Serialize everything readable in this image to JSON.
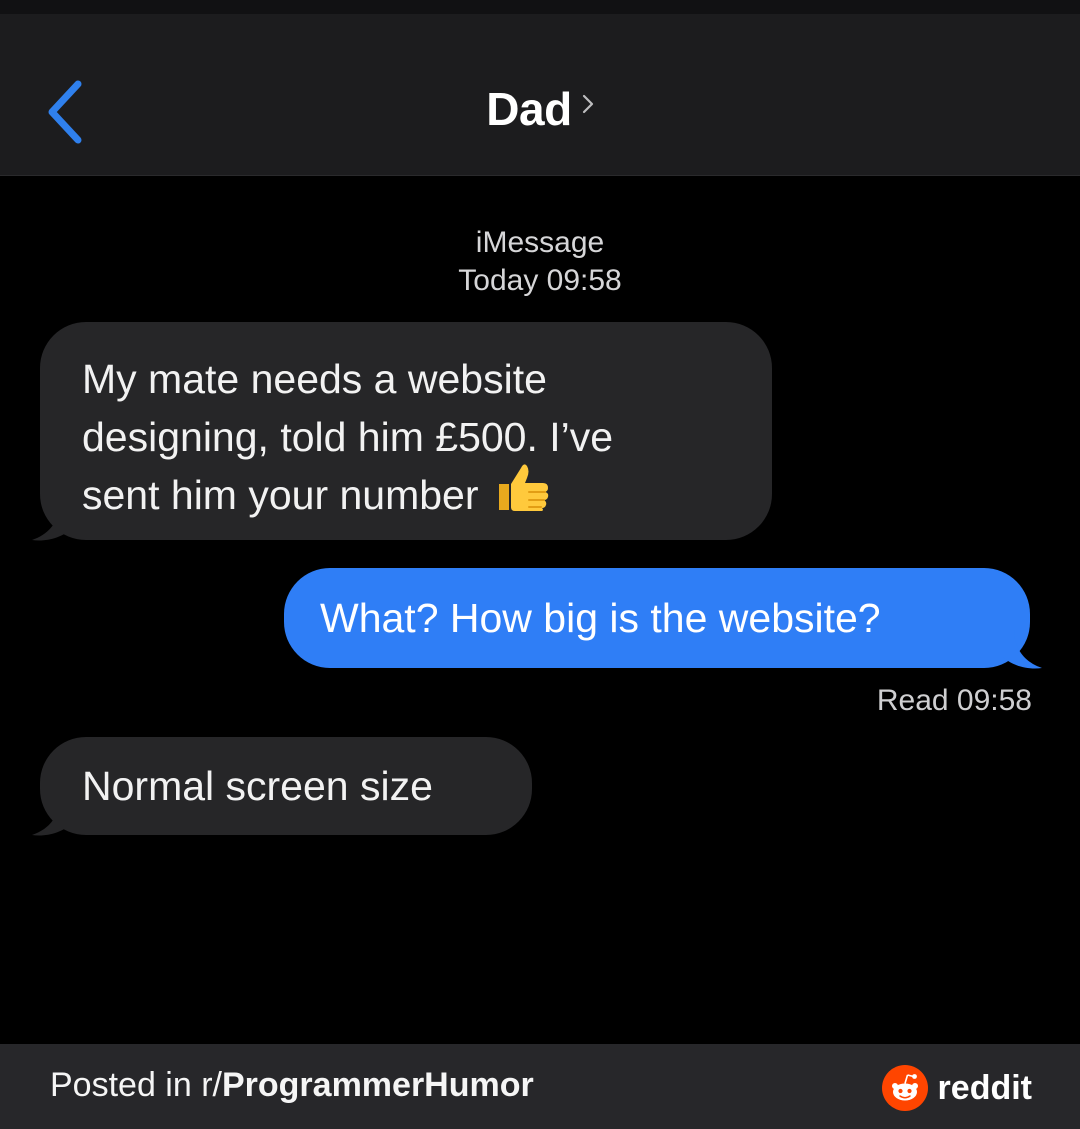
{
  "header": {
    "back_icon": "chevron-left-icon",
    "contact_name": "Dad",
    "details_icon": "chevron-right-icon"
  },
  "conversation": {
    "service": "iMessage",
    "timestamp": "Today 09:58",
    "messages": [
      {
        "direction": "incoming",
        "lines": [
          "My mate needs a website",
          "designing, told him £500. I’ve",
          "sent him your number"
        ],
        "emoji": "👍",
        "emoji_icon": "thumbs-up-icon"
      },
      {
        "direction": "outgoing",
        "text": "What? How big is the website?"
      },
      {
        "direction": "incoming",
        "text": "Normal screen size"
      }
    ],
    "read_receipt": "Read 09:58"
  },
  "footer": {
    "posted_prefix": "Posted in r/",
    "subreddit": "ProgrammerHumor",
    "brand": "reddit",
    "brand_icon": "reddit-alien-icon"
  },
  "colors": {
    "background": "#000000",
    "header_bg": "#1c1c1e",
    "incoming_bubble": "#262628",
    "outgoing_bubble": "#2f7ef6",
    "ios_blue": "#2f80ed",
    "footer_bg": "#27272a",
    "reddit_orange": "#ff4500"
  }
}
